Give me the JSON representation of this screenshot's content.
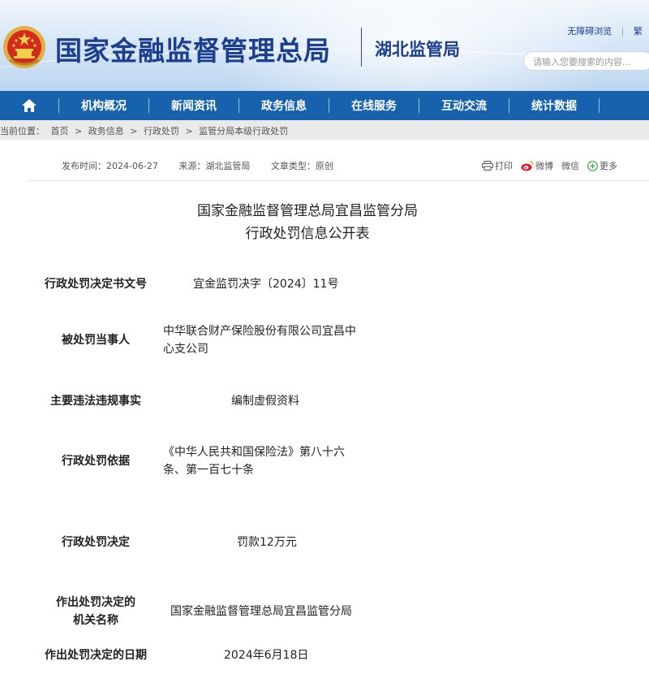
{
  "header": {
    "site_title": "国家金融监督管理总局",
    "sub_title": "湖北监管局",
    "accessibility_link": "无障碍浏览",
    "traditional_link": "繁",
    "search_placeholder": "请输入您要搜索的内容..."
  },
  "nav": {
    "items": [
      "机构概况",
      "新闻资讯",
      "政务信息",
      "在线服务",
      "互动交流",
      "统计数据"
    ]
  },
  "breadcrumb": {
    "prefix": "当前位置：",
    "items": [
      "首页",
      "政务信息",
      "行政处罚",
      "监管分局本级行政处罚"
    ],
    "separator": ">"
  },
  "meta": {
    "publish_time": "发布时间：2024-06-27",
    "source": "来源：湖北监管局",
    "doc_type": "文章类型：原创"
  },
  "share": {
    "print": "打印",
    "weibo": "微博",
    "wechat": "微信",
    "more": "更多"
  },
  "doc": {
    "title_line1": "国家金融监督管理总局宜昌监管分局",
    "title_line2": "行政处罚信息公开表"
  },
  "table": {
    "rows": [
      {
        "label": "行政处罚决定书文号",
        "value": "宜金监罚决字〔2024〕11号"
      },
      {
        "label": "被处罚当事人",
        "value_line1": "中华联合财产保险股份有限公司宜昌中",
        "value_line2": "心支公司"
      },
      {
        "label": "主要违法违规事实",
        "value": "编制虚假资料"
      },
      {
        "label": "行政处罚依据",
        "value_line1": "《中华人民共和国保险法》第八十六",
        "value_line2": "条、第一百七十条"
      },
      {
        "label": "行政处罚决定",
        "value": "罚款12万元"
      },
      {
        "label_line1": "作出处罚决定的",
        "label_line2": "机关名称",
        "value": "国家金融监督管理总局宜昌监管分局"
      },
      {
        "label": "作出处罚决定的日期",
        "value": "2024年6月18日"
      }
    ]
  },
  "colors": {
    "nav_blue": "#1761ad",
    "title_blue": "#1c3e8e"
  }
}
